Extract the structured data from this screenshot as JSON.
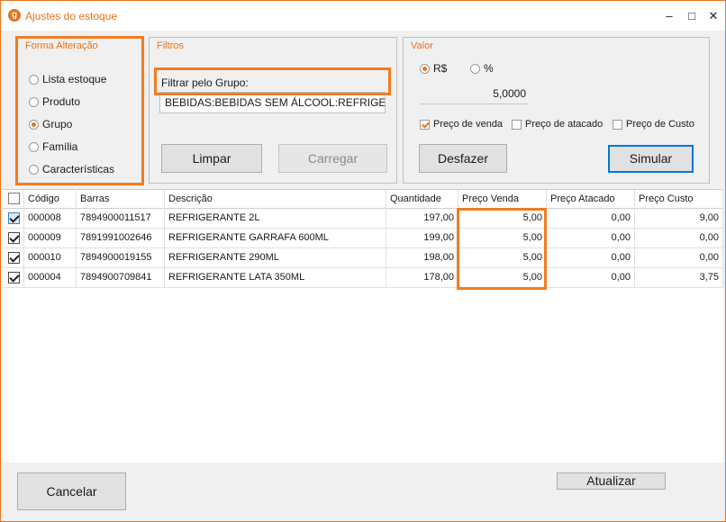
{
  "window": {
    "title": "Ajustes do estoque",
    "app_icon_glyph": "g",
    "accent_color": "#e8731a",
    "highlight_color": "#ef7d22",
    "controls": {
      "minimize": "–",
      "maximize": "□",
      "close": "✕"
    }
  },
  "forma_alteracao": {
    "title": "Forma Alteração",
    "options": [
      {
        "label": "Lista estoque",
        "checked": false
      },
      {
        "label": "Produto",
        "checked": false
      },
      {
        "label": "Grupo",
        "checked": true
      },
      {
        "label": "Família",
        "checked": false
      },
      {
        "label": "Características",
        "checked": false
      }
    ]
  },
  "filtros": {
    "title": "Filtros",
    "filter_label": "Filtrar pelo Grupo:",
    "selected_group": "BEBIDAS:BEBIDAS SEM ÁLCOOL:REFRIGERANTES",
    "limpar_button": "Limpar",
    "carregar_button": "Carregar"
  },
  "valor": {
    "title": "Valor",
    "mode_options": [
      {
        "label": "R$",
        "checked": true
      },
      {
        "label": "%",
        "checked": false
      }
    ],
    "amount": "5,0000",
    "price_targets": [
      {
        "label": "Preço de venda",
        "checked": true
      },
      {
        "label": "Preço de atacado",
        "checked": false
      },
      {
        "label": "Preço de Custo",
        "checked": false
      }
    ],
    "desfazer_button": "Desfazer",
    "simular_button": "Simular"
  },
  "grid": {
    "columns": [
      "Código",
      "Barras",
      "Descrição",
      "Quantidade",
      "Preço Venda",
      "Preço Atacado",
      "Preço Custo"
    ],
    "rows": [
      {
        "selected": true,
        "codigo": "000008",
        "barras": "7894900011517",
        "descricao": "REFRIGERANTE  2L",
        "quantidade": "197,00",
        "preco_venda": "5,00",
        "preco_atacado": "0,00",
        "preco_custo": "9,00"
      },
      {
        "selected": true,
        "codigo": "000009",
        "barras": "7891991002646",
        "descricao": "REFRIGERANTE GARRAFA 600ML",
        "quantidade": "199,00",
        "preco_venda": "5,00",
        "preco_atacado": "0,00",
        "preco_custo": "0,00"
      },
      {
        "selected": true,
        "codigo": "000010",
        "barras": "7894900019155",
        "descricao": "REFRIGERANTE 290ML",
        "quantidade": "198,00",
        "preco_venda": "5,00",
        "preco_atacado": "0,00",
        "preco_custo": "0,00"
      },
      {
        "selected": true,
        "codigo": "000004",
        "barras": "7894900709841",
        "descricao": "REFRIGERANTE LATA 350ML",
        "quantidade": "178,00",
        "preco_venda": "5,00",
        "preco_atacado": "0,00",
        "preco_custo": "3,75"
      }
    ]
  },
  "footer": {
    "cancelar_button": "Cancelar",
    "atualizar_button": "Atualizar"
  }
}
